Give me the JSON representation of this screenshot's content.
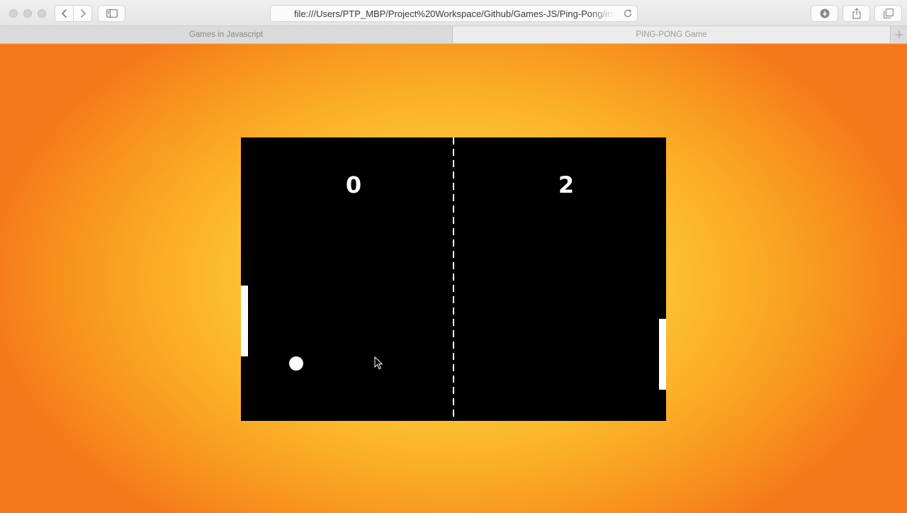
{
  "browser": {
    "url": "file:///Users/PTP_MBP/Project%20Workspace/Github/Games-JS/Ping-Pong/inde",
    "tabs": [
      {
        "label": "Games in Javascript",
        "active": false
      },
      {
        "label": "PING-PONG Game",
        "active": true
      }
    ],
    "icons": [
      "back-icon",
      "forward-icon",
      "sidebar-icon",
      "reload-icon",
      "download-icon",
      "share-icon",
      "tabs-overview-icon",
      "new-tab-icon"
    ]
  },
  "game": {
    "score_left": "0",
    "score_right": "2",
    "colors": {
      "board": "#000000",
      "foreground": "#ffffff",
      "background_center": "#fee04a",
      "background_edge": "#f5791a"
    }
  }
}
